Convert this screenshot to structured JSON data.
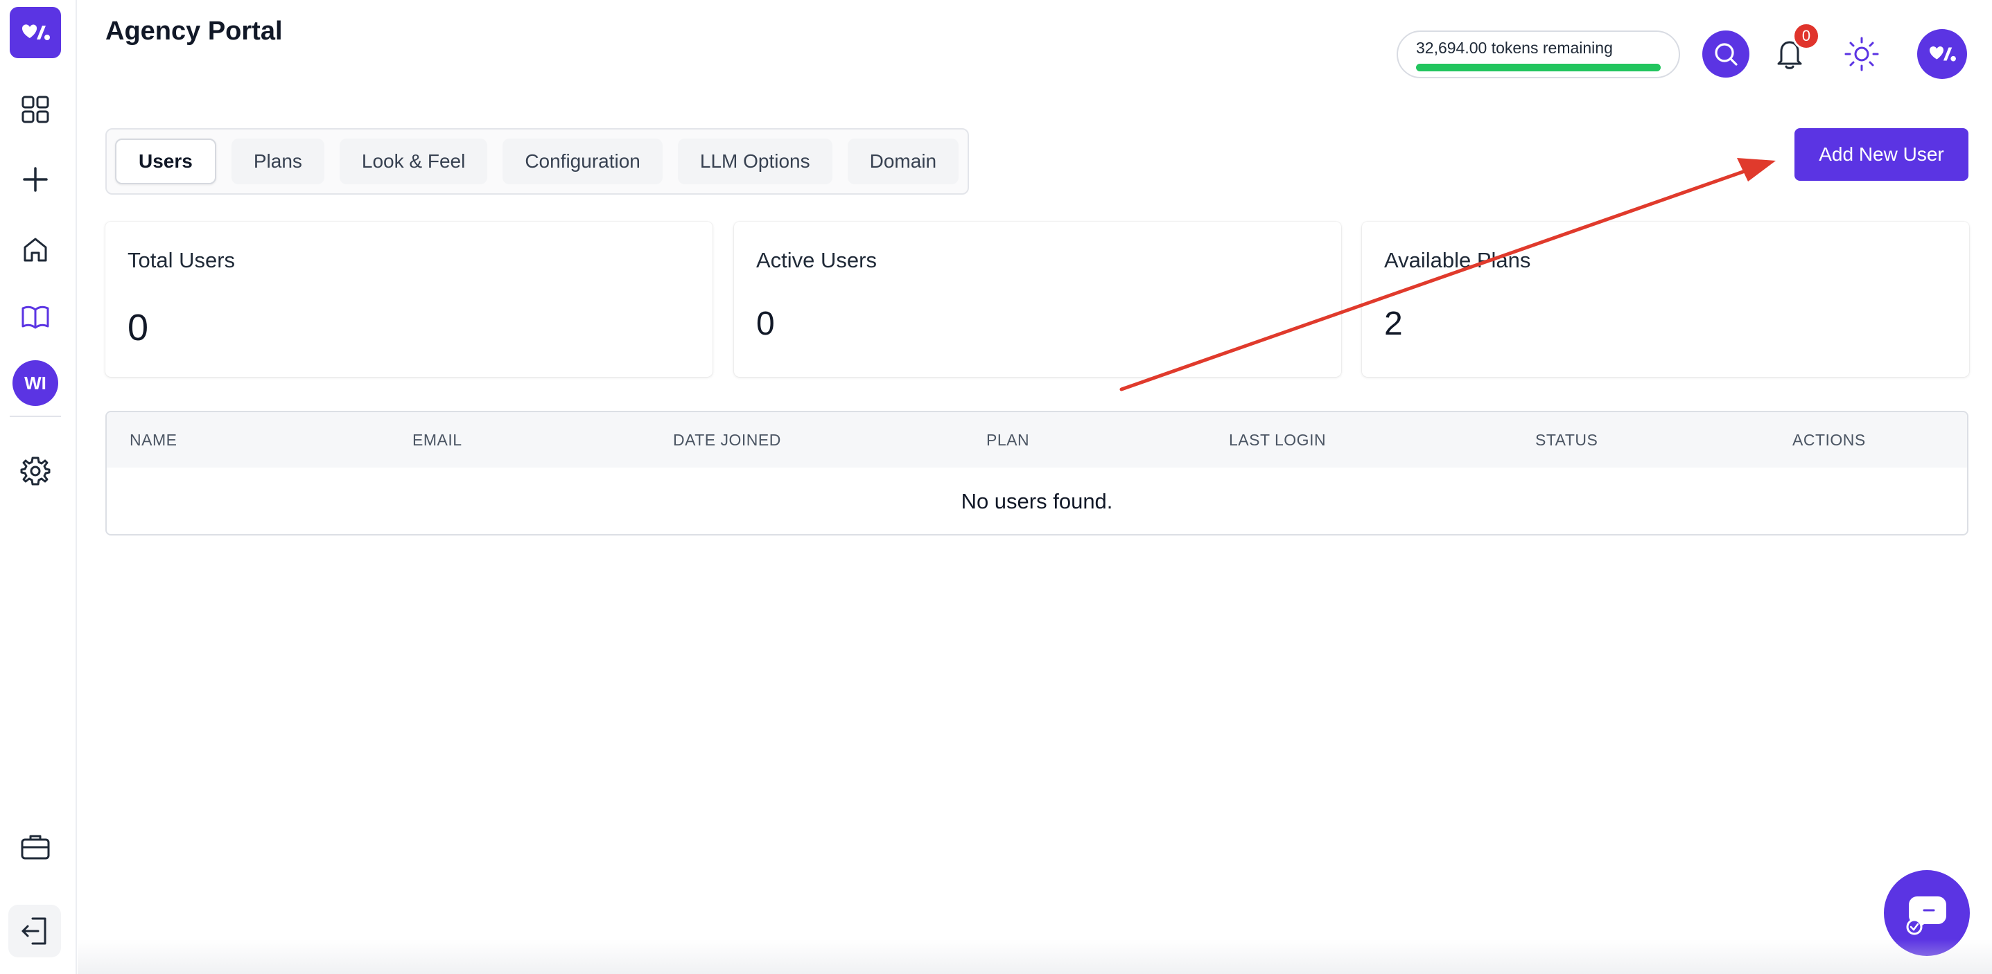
{
  "header": {
    "title": "Agency Portal",
    "tokens_text": "32,694.00 tokens remaining",
    "tokens_fraction": 1.0,
    "notification_count": "0"
  },
  "sidebar": {
    "avatar_initials": "WI",
    "items": [
      {
        "icon": "grid-icon"
      },
      {
        "icon": "plus-icon"
      },
      {
        "icon": "home-icon"
      },
      {
        "icon": "book-icon"
      },
      {
        "icon": "settings-icon"
      },
      {
        "icon": "briefcase-icon"
      },
      {
        "icon": "logout-icon"
      }
    ]
  },
  "tabs": [
    {
      "label": "Users",
      "active": true
    },
    {
      "label": "Plans",
      "active": false
    },
    {
      "label": "Look & Feel",
      "active": false
    },
    {
      "label": "Configuration",
      "active": false
    },
    {
      "label": "LLM Options",
      "active": false
    },
    {
      "label": "Domain",
      "active": false
    }
  ],
  "actions": {
    "add_user_label": "Add New User"
  },
  "stats": [
    {
      "label": "Total Users",
      "value": "0"
    },
    {
      "label": "Active Users",
      "value": "0"
    },
    {
      "label": "Available Plans",
      "value": "2"
    }
  ],
  "table": {
    "columns": [
      "NAME",
      "EMAIL",
      "DATE JOINED",
      "PLAN",
      "LAST LOGIN",
      "STATUS",
      "ACTIONS"
    ],
    "empty_message": "No users found."
  },
  "colors": {
    "accent": "#5b34e3",
    "progress": "#22c55e",
    "badge": "#e0342c",
    "annotation_arrow": "#e03a2c"
  }
}
